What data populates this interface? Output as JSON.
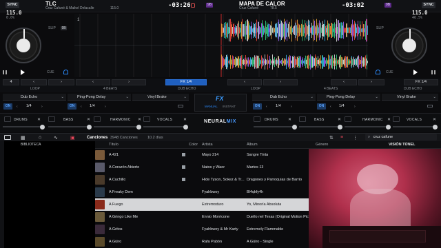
{
  "deck_left": {
    "sync_label": "SYNC",
    "track_title": "TLC",
    "artist": "Cruz Cafuné & Maikel Delacalle",
    "track_bpm": "115.0",
    "time_remaining": "-03:26",
    "bpm": "115.0",
    "pitch": "0.0%",
    "key_badge": "9B",
    "slip_label": "SLIP",
    "cue_label": "CUE",
    "loop_value": "4",
    "marker": "1"
  },
  "deck_right": {
    "sync_label": "SYNC",
    "track_title": "MAPA DE CALOR",
    "artist": "Cruz Cafuné",
    "track_bpm": "78.5",
    "time_remaining": "-03:02",
    "bpm": "115.0",
    "pitch": "46.5%",
    "key_badge": "9B",
    "slip_label": "SLIP",
    "cue_label": "CUE",
    "loop_value": "4",
    "marker": "2"
  },
  "center_bar": {
    "loop_label": "LOOP",
    "beats_label": "4 BEATS",
    "fx_label": "FX 1/4",
    "dub_echo_label": "DUB ECHO",
    "right_loop_label": "LOOP",
    "right_beats_label": "4 BEATS",
    "right_fx_label": "FX 1/4",
    "right_dub_label": "DUB ECHO"
  },
  "fx_left": {
    "effects": [
      "Dub Echo",
      "Ping-Pong Delay",
      "Vinyl Brake"
    ],
    "on_label": "ON",
    "values": [
      "1/4",
      "1/4",
      "1/4"
    ]
  },
  "fx_right": {
    "effects": [
      "Dub Echo",
      "Ping-Pong Delay",
      "Vinyl Brake"
    ],
    "on_label": "ON",
    "values": [
      "1/4",
      "1/4",
      "1/4"
    ]
  },
  "fx_center": {
    "logo": "FX",
    "manual": "MANUAL",
    "instant": "INSTANT",
    "neural": "NEURAL",
    "mix": "MIX"
  },
  "stems": {
    "left": [
      "DRUMS",
      "BASS",
      "HARMONIC",
      "VOCALS"
    ],
    "right": [
      "DRUMS",
      "BASS",
      "HARMONIC",
      "VOCALS"
    ]
  },
  "library": {
    "tab_label": "Canciones",
    "count": "3948 Canciones",
    "duration": "10.2 días",
    "sidebar_label": "BIBLIOTECA",
    "search_value": "cruz cafune",
    "panel_label": "VISIÓN TÚNEL",
    "columns": {
      "title": "Título",
      "color": "Color",
      "artist": "Artista",
      "album": "Álbum",
      "genre": "Género"
    },
    "rows": [
      {
        "title": "A 421",
        "artist": "Mayo 214",
        "album": "Sangre Tinta",
        "thumb": "#7a5a3a"
      },
      {
        "title": "A Corazón Abierto",
        "artist": "Natos y Waor",
        "album": "Martes 13",
        "thumb": "#5a5a6a"
      },
      {
        "title": "A Cuchillo",
        "artist": "Hide Tyson, Sokez & Tr...",
        "album": "Dragones y Parroquias de Barrio",
        "thumb": "#4a3a2a"
      },
      {
        "title": "A Freaky Dem",
        "artist": "Fyahbwoy",
        "album": "Bl4qkfy4h",
        "thumb": "#2a3a4a"
      },
      {
        "title": "A Fuego",
        "artist": "Extremoduro",
        "album": "Yo, Minoría Absoluta",
        "thumb": "#8a2a1a"
      },
      {
        "title": "A Gringo Like Me",
        "artist": "Ennio Morricone",
        "album": "Duello nel Texas (Original Motion Pict...",
        "thumb": "#6a5a3a"
      },
      {
        "title": "A Gritos",
        "artist": "Fyahbwoy & Mr Karty",
        "album": "Extremely Flammable",
        "thumb": "#3a2a3a"
      },
      {
        "title": "A Güiro",
        "artist": "Rafa Pabón",
        "album": "A Güiro - Single",
        "thumb": "#5a4a2a"
      }
    ]
  },
  "colors": {
    "accent_blue": "#4a9bff",
    "selected_row": "#d5d6d8",
    "webcam_red": "#c4375a"
  }
}
